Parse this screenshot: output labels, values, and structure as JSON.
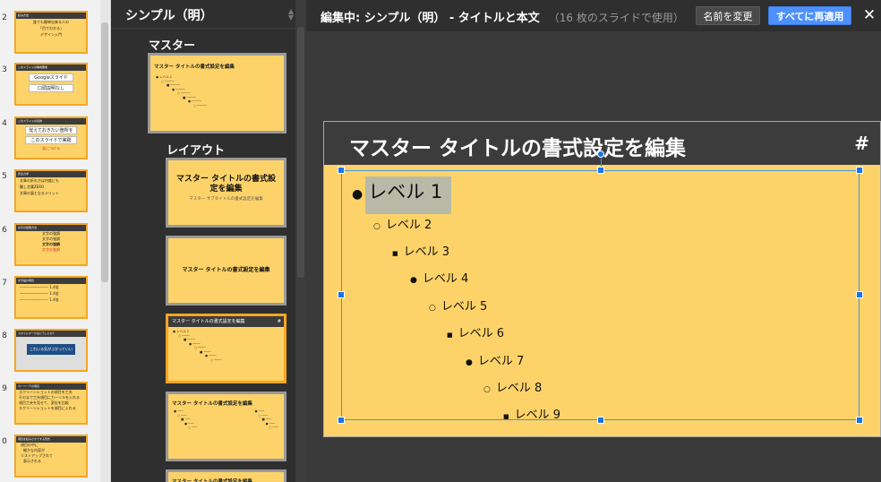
{
  "filmstrip": {
    "numbers": [
      "2",
      "3",
      "4",
      "5",
      "6",
      "7",
      "8",
      "9",
      "0"
    ],
    "slides": [
      {
        "head": "読み方法",
        "lines": [
          "誰でも簡単出来る人の",
          "「目でわかる」",
          "デザイン入門"
        ]
      },
      {
        "head": "このスライドの構成要素",
        "boxes": [
          "Googleスライド",
          "口頭説明なし"
        ]
      },
      {
        "head": "このスライドの目的",
        "boxes": [
          "覚えておきたい箇所を",
          "このスライドで実践"
        ],
        "red": "身につける"
      },
      {
        "head": "安全力学",
        "lines": [
          "文章の折れ方は何度にも",
          "難し言葉ZERO",
          "文章の量となるメリット"
        ]
      },
      {
        "head": "文字の装飾方法",
        "lines": [
          "文字の強調",
          "文字の強調",
          "文字の強調",
          "文字の強調"
        ]
      },
      {
        "head": "文字設計項目",
        "lines": [
          "————————  1.4倍",
          "————————  1.4倍",
          "————————  1.4倍"
        ]
      },
      {
        "head": "スマイルマークはどうしたか？",
        "blue": "これいる気がぶかっていい"
      },
      {
        "head": "カーヘーテの項目",
        "lines": [
          "スクリーンショットの項目を工夫",
          "そのまで工夫項目にカーソルを入れる",
          "項目工夫を見せて、変化を比較",
          "スクリーンショットを項目に入れる"
        ]
      },
      {
        "head": "項目を読みさきでする形式",
        "lines": [
          "項目の中に",
          "細かな内容が",
          "リストアップされて",
          "表示される"
        ]
      }
    ]
  },
  "panel": {
    "title": "シンプル（明）",
    "master_label": "マスター",
    "layout_label": "レイアウト",
    "master_thumb_title": "マスター タイトルの書式設定を編集",
    "master_thumb_level": "● レベル 1",
    "layouts": [
      {
        "big": "マスター タイトルの書式設定を編集",
        "sub": "マスター サブタイトルの書式設定を編集"
      },
      {
        "mid": "マスター タイトルの書式設定を編集"
      },
      {
        "head": "マスター タイトルの書式設定を編集",
        "hash": "#",
        "level": "● レベル 1"
      },
      {
        "title": "マスター タイトルの書式設定を編集"
      },
      {
        "title": "マスター タイトルの書式設定を編集"
      }
    ]
  },
  "toolbar": {
    "editing": "編集中: シンプル（明） - タイトルと本文",
    "usage": "（16 枚のスライドで使用）",
    "rename": "名前を変更",
    "reapply": "すべてに再適用",
    "close": "✕"
  },
  "slide": {
    "title": "マスター タイトルの書式設定を編集",
    "hash": "#",
    "levels": [
      {
        "bullet": "●",
        "text": "レベル 1"
      },
      {
        "bullet": "○",
        "text": "レベル 2"
      },
      {
        "bullet": "■",
        "text": "レベル 3"
      },
      {
        "bullet": "●",
        "text": "レベル 4"
      },
      {
        "bullet": "○",
        "text": "レベル 5"
      },
      {
        "bullet": "■",
        "text": "レベル 6"
      },
      {
        "bullet": "●",
        "text": "レベル 7"
      },
      {
        "bullet": "○",
        "text": "レベル 8"
      },
      {
        "bullet": "■",
        "text": "レベル 9"
      }
    ]
  },
  "colors": {
    "slide_bg": "#fdd369",
    "header_bg": "#3c3c3c",
    "accent": "#4d90fe",
    "selection_border": "#f5a623"
  }
}
